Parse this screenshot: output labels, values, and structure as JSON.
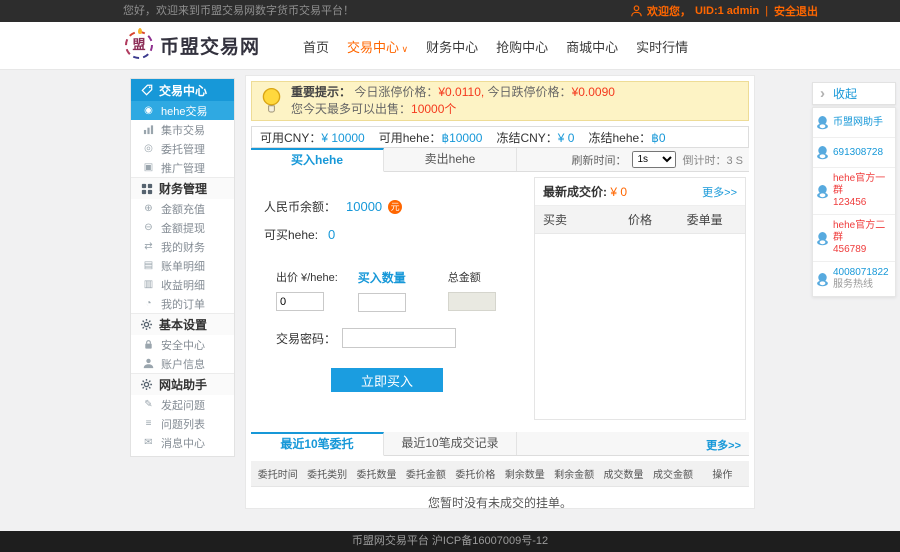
{
  "topbar": {
    "welcome": "您好，欢迎来到币盟交易网数字货币交易平台！",
    "greeting": "欢迎您，",
    "uid": "UID:1 admin",
    "divider": "|",
    "logout": "安全退出"
  },
  "header": {
    "logo_glyph": "盟",
    "logo_text": "币盟交易网",
    "nav": [
      {
        "label": "首页",
        "active": false,
        "arrow": false
      },
      {
        "label": "交易中心",
        "active": true,
        "arrow": true
      },
      {
        "label": "财务中心",
        "active": false,
        "arrow": false
      },
      {
        "label": "抢购中心",
        "active": false,
        "arrow": false
      },
      {
        "label": "商城中心",
        "active": false,
        "arrow": false
      },
      {
        "label": "实时行情",
        "active": false,
        "arrow": false
      }
    ]
  },
  "sidebar": {
    "groups": [
      {
        "title": "交易中心",
        "icon": "tag-icon",
        "primary": true,
        "items": [
          {
            "label": "hehe交易",
            "icon": "coin-icon",
            "active": true
          },
          {
            "label": "集市交易",
            "icon": "bar-chart-icon",
            "active": false
          },
          {
            "label": "委托管理",
            "icon": "order-icon",
            "active": false
          },
          {
            "label": "推广管理",
            "icon": "promo-icon",
            "active": false
          }
        ]
      },
      {
        "title": "财务管理",
        "icon": "finance-icon",
        "primary": false,
        "items": [
          {
            "label": "金额充值",
            "icon": "recharge-icon",
            "active": false
          },
          {
            "label": "金额提现",
            "icon": "withdraw-icon",
            "active": false
          },
          {
            "label": "我的财务",
            "icon": "my-finance-icon",
            "active": false
          },
          {
            "label": "账单明细",
            "icon": "bill-icon",
            "active": false
          },
          {
            "label": "收益明细",
            "icon": "income-icon",
            "active": false
          },
          {
            "label": "我的订单",
            "icon": "orders-icon",
            "active": false
          }
        ]
      },
      {
        "title": "基本设置",
        "icon": "gear-icon",
        "primary": false,
        "items": [
          {
            "label": "安全中心",
            "icon": "lock-icon",
            "active": false
          },
          {
            "label": "账户信息",
            "icon": "user-icon",
            "active": false
          }
        ]
      },
      {
        "title": "网站助手",
        "icon": "gear-icon",
        "primary": false,
        "items": [
          {
            "label": "发起问题",
            "icon": "compose-icon",
            "active": false
          },
          {
            "label": "问题列表",
            "icon": "list-icon",
            "active": false
          },
          {
            "label": "消息中心",
            "icon": "message-icon",
            "active": false
          }
        ]
      }
    ]
  },
  "notice": {
    "label": "重要提示：",
    "line1_text1": "今日涨停价格：",
    "line1_value1": "¥0.0110,",
    "line1_text2": "今日跌停价格：",
    "line1_value2": "¥0.0090",
    "line2_text": "您今天最多可以出售：",
    "line2_value": "10000个"
  },
  "balances": [
    {
      "label": "可用CNY：",
      "value": "¥ 10000"
    },
    {
      "label": "可用hehe：",
      "value": "฿10000"
    },
    {
      "label": "冻结CNY：",
      "value": "¥ 0"
    },
    {
      "label": "冻结hehe：",
      "value": "฿0"
    }
  ],
  "trade_tabs": {
    "buy": "买入hehe",
    "sell": "卖出hehe",
    "refresh_label": "刷新时间：",
    "refresh_value": "1s",
    "countdown_label": "倒计时：",
    "countdown_value": "3 S"
  },
  "buy_form": {
    "balance_label": "人民币余额：",
    "balance_value": "10000",
    "coin_glyph": "元",
    "can_buy_label": "可买hehe:",
    "can_buy_value": "0",
    "price_label": "出价 ¥/hehe:",
    "price_value": "0",
    "amount_label": "买入数量",
    "total_label": "总金额",
    "password_label": "交易密码：",
    "submit_label": "立即买入"
  },
  "orderbook": {
    "latest_label": "最新成交价:",
    "latest_value": "¥ 0",
    "more_link": "更多>>",
    "headers": [
      "买卖",
      "价格",
      "委单量"
    ]
  },
  "history": {
    "tab_active": "最近10笔委托",
    "tab_inactive": "最近10笔成交记录",
    "more_link": "更多>>",
    "headers": [
      "委托时间",
      "委托类别",
      "委托数量",
      "委托金额",
      "委托价格",
      "剩余数量",
      "剩余金额",
      "成交数量",
      "成交金额",
      "操作"
    ],
    "empty_text": "您暂时没有未成交的挂单。"
  },
  "service_panel": {
    "collapse_label": "收起",
    "items": [
      {
        "lines": [
          "币盟网助手"
        ],
        "color": "blue"
      },
      {
        "lines": [
          "691308728"
        ],
        "color": "blue"
      },
      {
        "lines": [
          "hehe官方一群",
          "123456"
        ],
        "color": "red"
      },
      {
        "lines": [
          "hehe官方二群",
          "456789"
        ],
        "color": "red"
      },
      {
        "lines": [
          "4008071822",
          "服务热线"
        ],
        "color": "blue-gray"
      }
    ]
  },
  "footer": {
    "text": "币盟网交易平台 沪ICP备16007009号-12"
  },
  "colors": {
    "accent_blue": "#1798d8",
    "accent_orange": "#ff6600",
    "alert_red": "#f43a1e"
  }
}
